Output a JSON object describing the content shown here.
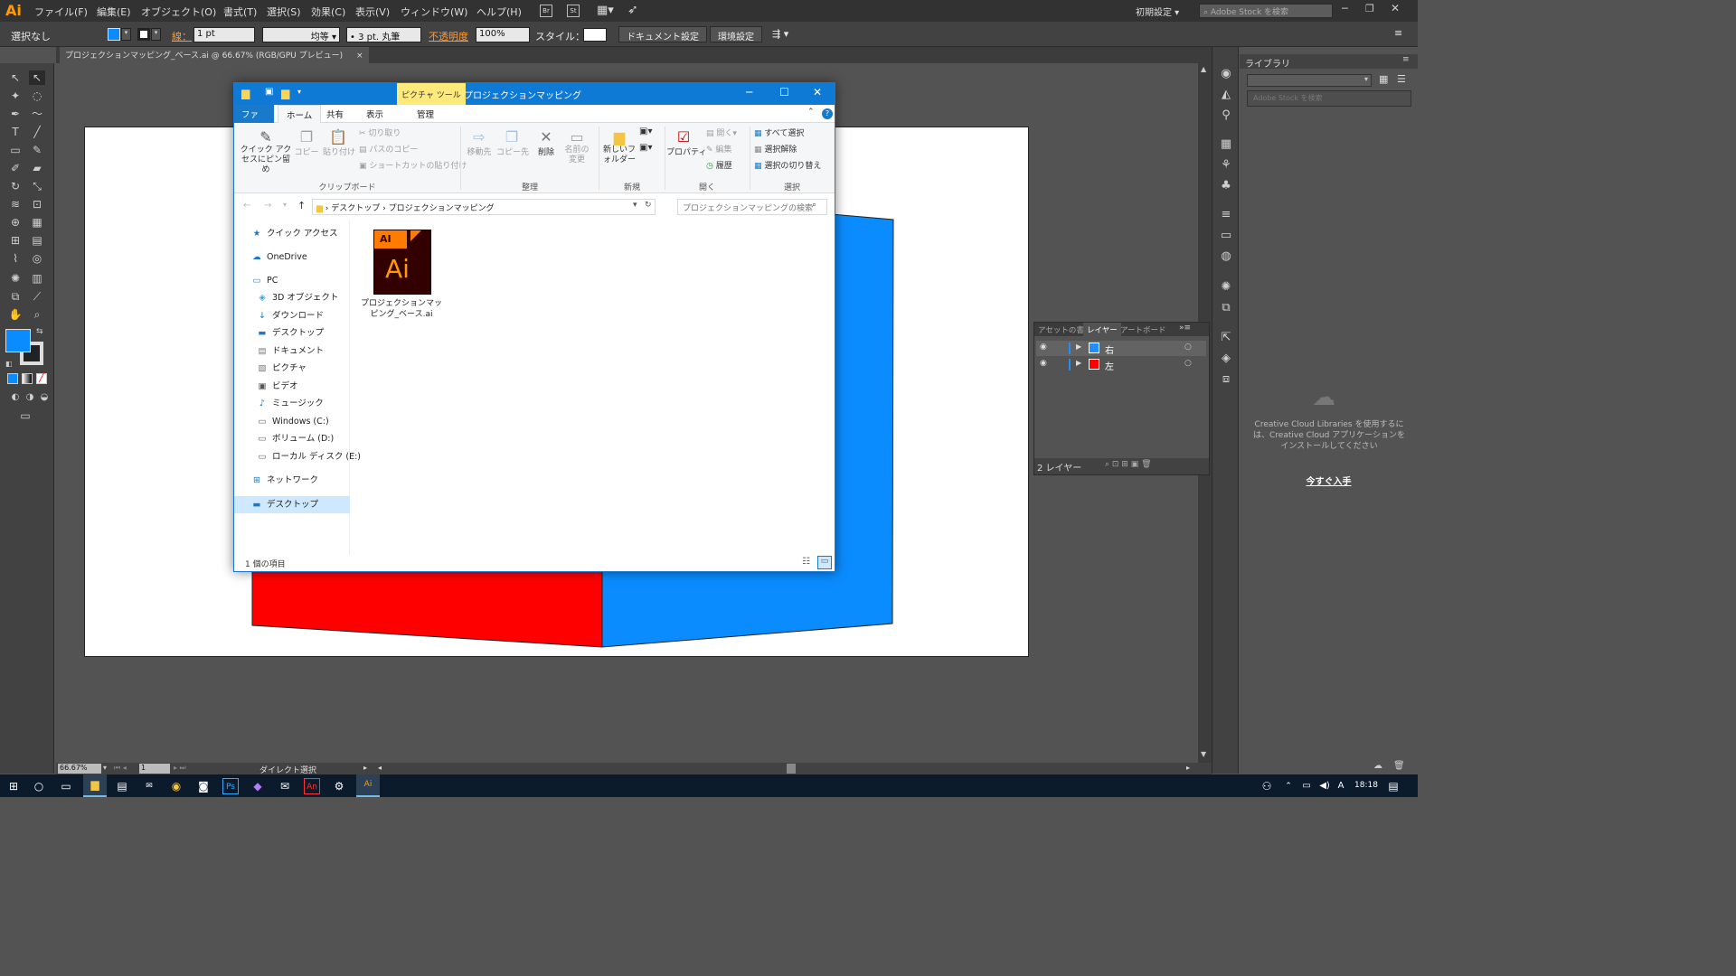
{
  "app": {
    "logo": "Ai",
    "menu": [
      "ファイル(F)",
      "編集(E)",
      "オブジェクト(O)",
      "書式(T)",
      "選択(S)",
      "効果(C)",
      "表示(V)",
      "ウィンドウ(W)",
      "ヘルプ(H)"
    ],
    "bridge_icons": [
      "Br",
      "St"
    ],
    "workspace": "初期設定",
    "stock_search_placeholder": "Adobe Stock を検索"
  },
  "control_bar": {
    "selection": "選択なし",
    "stroke_label": "線：",
    "stroke_value": "1 pt",
    "stroke_style": "均等",
    "brush": "3 pt. 丸筆",
    "opacity_label": "不透明度",
    "opacity_value": "100%",
    "style_label": "スタイル：",
    "doc_settings": "ドキュメント設定",
    "preferences": "環境設定"
  },
  "document_tab": {
    "title": "プロジェクションマッピング_ベース.ai @ 66.67% (RGB/GPU プレビュー)",
    "close": "×"
  },
  "status_bar": {
    "zoom": "66.67%",
    "page": "1",
    "tool": "ダイレクト選択"
  },
  "layers_panel": {
    "tabs": [
      "アセットの書",
      "レイヤー",
      "アートボード"
    ],
    "layers": [
      {
        "name": "右",
        "color": "#1f8fff"
      },
      {
        "name": "左",
        "color": "#ff0000"
      }
    ],
    "footer": "2 レイヤー"
  },
  "library_panel": {
    "title": "ライブラリ",
    "search_placeholder": "Adobe Stock を検索",
    "message": "Creative Cloud Libraries を使用するには、Creative Cloud アプリケーションをインストールしてください",
    "link": "今すぐ入手"
  },
  "explorer": {
    "context_tab": "ピクチャ ツール",
    "title": "プロジェクションマッピング",
    "tabs": [
      "ファイル",
      "ホーム",
      "共有",
      "表示",
      "管理"
    ],
    "ribbon": {
      "clipboard": {
        "group": "クリップボード",
        "pin": "クイック アクセスにピン留め",
        "copy": "コピー",
        "paste": "貼り付け",
        "cut": "切り取り",
        "copy_path": "パスのコピー",
        "paste_shortcut": "ショートカットの貼り付け"
      },
      "organize": {
        "group": "整理",
        "move_to": "移動先",
        "copy_to": "コピー先",
        "delete": "削除",
        "rename": "名前の変更"
      },
      "new": {
        "group": "新規",
        "new_folder": "新しいフォルダー"
      },
      "open": {
        "group": "開く",
        "properties": "プロパティ",
        "open": "開く",
        "edit": "編集",
        "history": "履歴"
      },
      "select": {
        "group": "選択",
        "select_all": "すべて選択",
        "select_none": "選択解除",
        "invert": "選択の切り替え"
      }
    },
    "breadcrumb": [
      "デスクトップ",
      "プロジェクションマッピング"
    ],
    "search_placeholder": "プロジェクションマッピングの検索",
    "nav": [
      {
        "label": "クイック アクセス",
        "icon": "★",
        "indent": 0
      },
      {
        "label": "OneDrive",
        "icon": "☁",
        "indent": 0
      },
      {
        "label": "PC",
        "icon": "▭",
        "indent": 0
      },
      {
        "label": "3D オブジェクト",
        "icon": "◈",
        "indent": 1
      },
      {
        "label": "ダウンロード",
        "icon": "↓",
        "indent": 1
      },
      {
        "label": "デスクトップ",
        "icon": "▬",
        "indent": 1
      },
      {
        "label": "ドキュメント",
        "icon": "▤",
        "indent": 1
      },
      {
        "label": "ピクチャ",
        "icon": "▧",
        "indent": 1
      },
      {
        "label": "ビデオ",
        "icon": "▣",
        "indent": 1
      },
      {
        "label": "ミュージック",
        "icon": "♪",
        "indent": 1
      },
      {
        "label": "Windows (C:)",
        "icon": "▭",
        "indent": 1
      },
      {
        "label": "ボリューム (D:)",
        "icon": "▭",
        "indent": 1
      },
      {
        "label": "ローカル ディスク (E:)",
        "icon": "▭",
        "indent": 1
      },
      {
        "label": "ネットワーク",
        "icon": "⊞",
        "indent": 0
      },
      {
        "label": "デスクトップ",
        "icon": "▬",
        "indent": 0
      }
    ],
    "file": {
      "badge": "AI",
      "glyph": "Ai",
      "name": "プロジェクションマッピング_ベース.ai"
    },
    "status": "1 個の項目"
  },
  "taskbar": {
    "time": "18:18",
    "ime": "A"
  },
  "colors": {
    "blue": "#0a8cff",
    "red": "#ff0000",
    "accent": "#0f7ad6"
  }
}
